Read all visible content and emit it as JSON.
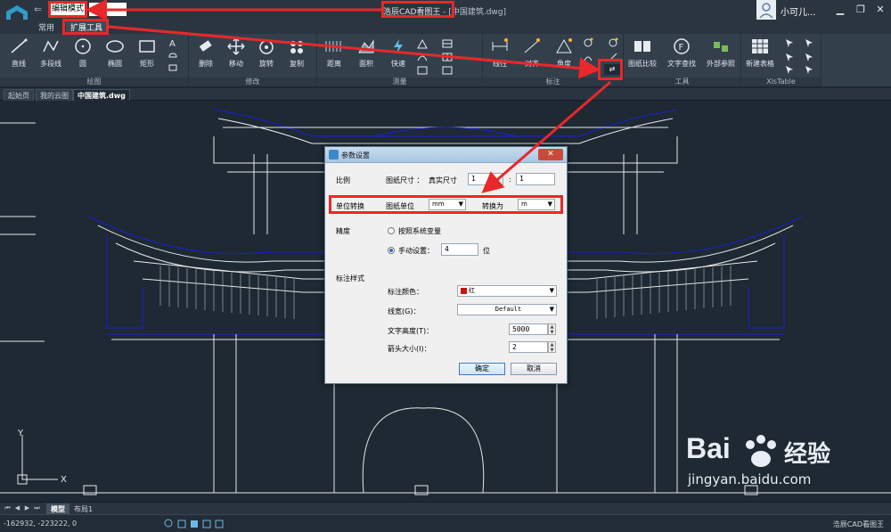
{
  "titlebar": {
    "mode_label": "编辑模式",
    "app_name": "浩辰CAD看图王",
    "doc_suffix": " - [中国建筑.dwg]",
    "user_name": "小可儿..."
  },
  "tabs": [
    {
      "label": "常用"
    },
    {
      "label": "扩展工具"
    }
  ],
  "ribbon": {
    "groups": [
      {
        "label": "绘图",
        "tools": [
          "直线",
          "多段线",
          "圆",
          "椭圆",
          "矩形"
        ]
      },
      {
        "label": "修改",
        "tools": [
          "删除",
          "移动",
          "旋转",
          "复制"
        ]
      },
      {
        "label": "测量",
        "tools": [
          "距离",
          "面积",
          "快速"
        ]
      },
      {
        "label": "标注",
        "tools": [
          "线性",
          "对齐",
          "角度"
        ]
      },
      {
        "label": "工具",
        "tools": [
          "图纸比较",
          "文字查找",
          "外部参照"
        ]
      },
      {
        "label": "XlsTable",
        "tools": [
          "新建表格"
        ]
      }
    ]
  },
  "doc_tabs": [
    {
      "label": "起始页"
    },
    {
      "label": "我的云图"
    },
    {
      "label": "中国建筑.dwg"
    }
  ],
  "dialog": {
    "title": "参数设置",
    "close_label": "✕",
    "scale_label": "比例",
    "paper_size_label": "图纸尺寸 ：",
    "real_size_label": "真实尺寸",
    "paper_value": "1",
    "colon": ":",
    "real_value": "1",
    "unit_conv_label": "单位转换",
    "paper_unit_label": "图纸单位",
    "paper_unit_value": "mm",
    "convert_to_label": "转换为",
    "convert_to_value": "m",
    "precision_label": "精度",
    "radio_system": "按照系统变量",
    "radio_manual": "手动设置：",
    "manual_value": "4",
    "digits_label": "位",
    "dim_style_label": "标注样式",
    "dim_color_label": "标注颜色：",
    "dim_color_value": "红",
    "linewidth_label": "线宽(G)：",
    "linewidth_value": "Default",
    "text_height_label": "文字高度(T)：",
    "text_height_value": "5000",
    "arrow_size_label": "箭头大小(I)：",
    "arrow_size_value": "2",
    "ok_label": "确定",
    "cancel_label": "取消"
  },
  "layout_tabs": [
    {
      "label": "模型"
    },
    {
      "label": "布局1"
    }
  ],
  "status": {
    "coords": "-162932, -223222, 0",
    "brand": "浩辰CAD看图王"
  },
  "watermark": {
    "brand": "Bai",
    "brand2": "经验",
    "url": "jingyan.baidu.com"
  },
  "colors": {
    "annotation_red": "#e8282a",
    "drawing_blue": "#1b1fd6",
    "drawing_white": "#e6e8ea",
    "dialog_bg": "#f0f0f0"
  }
}
